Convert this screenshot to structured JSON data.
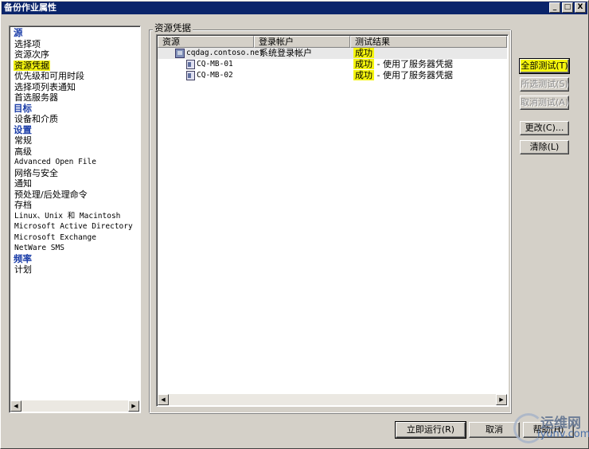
{
  "window": {
    "title": "备份作业属性",
    "controls": [
      "_",
      "□",
      "X"
    ]
  },
  "nav": {
    "items": [
      {
        "label": "源",
        "type": "head"
      },
      {
        "label": "选择项",
        "type": "item"
      },
      {
        "label": "资源次序",
        "type": "item"
      },
      {
        "label": "资源凭据",
        "type": "item",
        "selected": true
      },
      {
        "label": "优先级和可用时段",
        "type": "item"
      },
      {
        "label": "选择项列表通知",
        "type": "item"
      },
      {
        "label": "首选服务器",
        "type": "item"
      },
      {
        "label": "目标",
        "type": "head"
      },
      {
        "label": "设备和介质",
        "type": "item"
      },
      {
        "label": "设置",
        "type": "head"
      },
      {
        "label": "常规",
        "type": "item"
      },
      {
        "label": "高级",
        "type": "item"
      },
      {
        "label": "Advanced Open File",
        "type": "mono"
      },
      {
        "label": "网络与安全",
        "type": "item"
      },
      {
        "label": "通知",
        "type": "item"
      },
      {
        "label": "预处理/后处理命令",
        "type": "item"
      },
      {
        "label": "存档",
        "type": "item"
      },
      {
        "label": "Linux、Unix 和 Macintosh",
        "type": "mono"
      },
      {
        "label": "Microsoft Active Directory",
        "type": "mono"
      },
      {
        "label": "Microsoft Exchange",
        "type": "mono"
      },
      {
        "label": "NetWare SMS",
        "type": "mono"
      },
      {
        "label": "频率",
        "type": "head"
      },
      {
        "label": "计划",
        "type": "item"
      }
    ]
  },
  "panel": {
    "title": "资源凭据",
    "columns": [
      "资源",
      "登录帐户",
      "测试结果"
    ],
    "rows": [
      {
        "resource": "cqdag.contoso.net",
        "account": "系统登录帐户",
        "status": "成功",
        "note": "",
        "icon": "server-icon"
      },
      {
        "resource": "CQ-MB-01",
        "account": "",
        "status": "成功",
        "note": " - 使用了服务器凭据",
        "icon": "computer-icon"
      },
      {
        "resource": "CQ-MB-02",
        "account": "",
        "status": "成功",
        "note": " - 使用了服务器凭据",
        "icon": "computer-icon"
      }
    ]
  },
  "side_buttons": {
    "test_all": "全部测试(T)",
    "test_selected": "所选测试(S)",
    "cancel_test": "取消测试(A)",
    "change": "更改(C)...",
    "clear": "清除(L)"
  },
  "footer_buttons": {
    "run_now": "立即运行(R)",
    "cancel": "取消",
    "help": "帮助(H)"
  },
  "watermark": {
    "text1": "运维网",
    "text2": "iyunv.com"
  },
  "colors": {
    "highlight": "#f5f50e",
    "titlebar": "#0a246a",
    "heading": "#1c3ea8"
  }
}
